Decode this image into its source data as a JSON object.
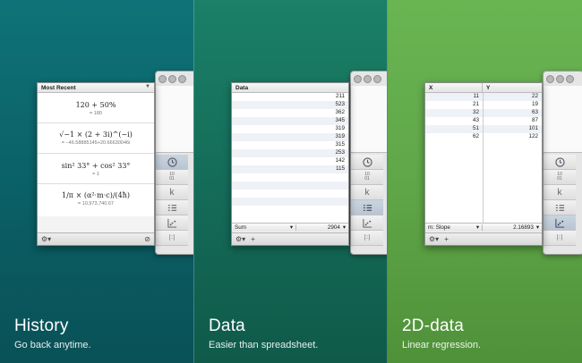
{
  "panels": [
    {
      "title": "History",
      "subtitle": "Go back anytime."
    },
    {
      "title": "Data",
      "subtitle": "Easier than spreadsheet."
    },
    {
      "title": "2D-data",
      "subtitle": "Linear regression."
    }
  ],
  "history": {
    "header": "Most Recent",
    "items": [
      {
        "expr": "120 + 50%",
        "result": "= 180"
      },
      {
        "expr": "√−1 × (2 + 3i)^(−i)",
        "result": "= −46.58885145+20.66630046i"
      },
      {
        "expr": "sin² 33° + cos² 33°",
        "result": "= 1"
      },
      {
        "expr": "1/π × (α²·m·c)/(4ħ)",
        "result": "= 10,973,740.67"
      }
    ]
  },
  "data": {
    "header": "Data",
    "values": [
      "211",
      "523",
      "362",
      "345",
      "319",
      "319",
      "315",
      "253",
      "142",
      "115"
    ],
    "aggregate_label": "Sum",
    "aggregate_value": "2904"
  },
  "data2d": {
    "col_x": "X",
    "col_y": "Y",
    "rows": [
      {
        "x": "11",
        "y": "22"
      },
      {
        "x": "21",
        "y": "19"
      },
      {
        "x": "32",
        "y": "63"
      },
      {
        "x": "43",
        "y": "87"
      },
      {
        "x": "51",
        "y": "101"
      },
      {
        "x": "62",
        "y": "122"
      }
    ],
    "stat_label": "m: Slope",
    "stat_value": "2.16893"
  },
  "sidebar_icons": [
    "history-icon",
    "binary-icon",
    "constants-icon",
    "list-icon",
    "chart-icon",
    "matrix-icon"
  ],
  "sidebar_labels": {
    "binary": "10\n01",
    "constants": "k",
    "matrix": "[::]"
  },
  "colors": {
    "teal": "#0a5f65",
    "green": "#146a57",
    "lime": "#5ea547"
  }
}
